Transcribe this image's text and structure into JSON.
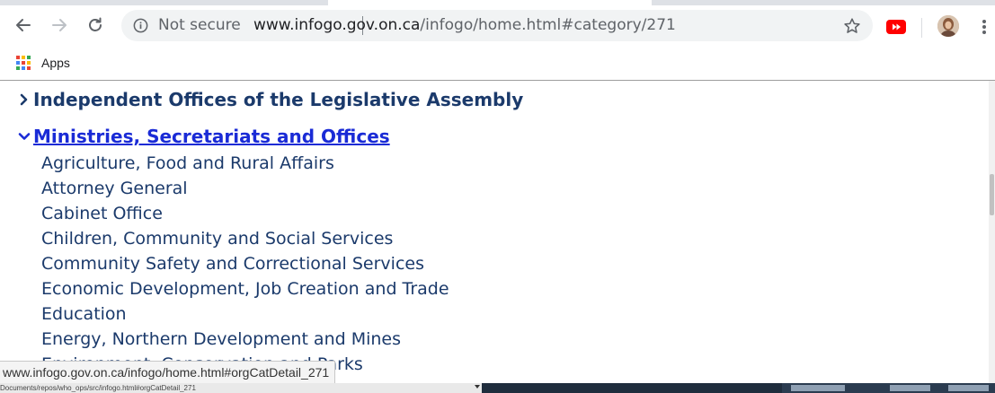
{
  "browser": {
    "security_label": "Not secure",
    "url_host": "www.infogo.gov.on.ca",
    "url_path": "/infogo/home.html#category/271",
    "bookmarks": [
      {
        "label": "Apps"
      }
    ],
    "apps_grid_colors": [
      "#ea4335",
      "#fbbc05",
      "#34a853",
      "#4285f4",
      "#ea4335",
      "#fbbc05",
      "#34a853",
      "#4285f4",
      "#ea4335"
    ]
  },
  "page": {
    "sections": [
      {
        "label": "Independent Offices of the Legislative Assembly",
        "expanded": false
      },
      {
        "label": "Ministries, Secretariats and Offices",
        "expanded": true
      }
    ],
    "ministries": [
      "Agriculture, Food and Rural Affairs",
      "Attorney General",
      "Cabinet Office",
      "Children, Community and Social Services",
      "Community Safety and Correctional Services",
      "Economic Development, Job Creation and Trade",
      "Education",
      "Energy, Northern Development and Mines",
      "Environment, Conservation and Parks"
    ]
  },
  "status_bar": {
    "hover_url": "www.infogo.gov.on.ca/infogo/home.html#orgCatDetail_271"
  },
  "os": {
    "path_text": "Documents/repos/who_ops/src/infogo.html#orgCatDetail_271"
  },
  "colors": {
    "link_navy": "#1b3a6b",
    "link_active": "#1a2bd6",
    "youtube_red": "#ff0000"
  }
}
